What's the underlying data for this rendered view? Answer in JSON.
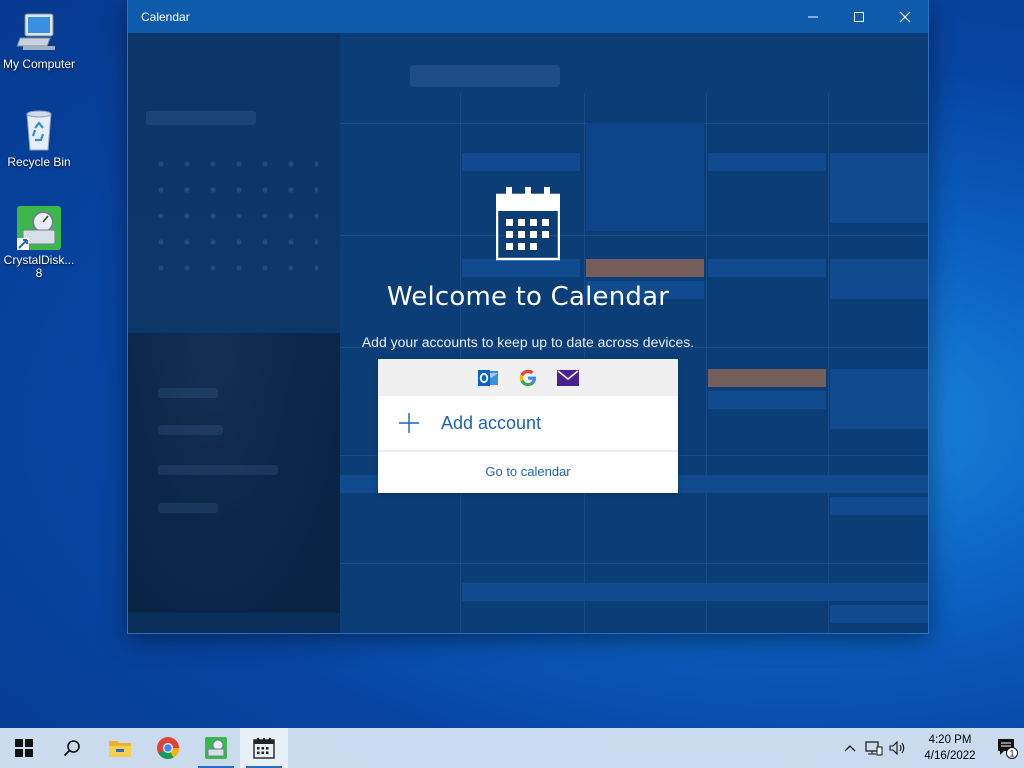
{
  "desktop": {
    "icons": [
      {
        "label": "My Computer",
        "icon": "computer-icon"
      },
      {
        "label": "Recycle Bin",
        "icon": "recycle-bin-icon"
      },
      {
        "label": "CrystalDisk...\n8",
        "icon": "crystaldisk-icon"
      }
    ]
  },
  "window": {
    "title": "Calendar",
    "controls": [
      "minimize",
      "maximize",
      "close"
    ]
  },
  "welcome": {
    "heading": "Welcome to Calendar",
    "subtitle": "Add your accounts to keep up to date across devices.",
    "providers": [
      "outlook-icon",
      "google-icon",
      "mail-icon"
    ],
    "add_account": "Add account",
    "go_to_calendar": "Go to calendar"
  },
  "taskbar": {
    "apps": [
      "start-icon",
      "search-icon",
      "file-explorer-icon",
      "chrome-icon",
      "crystaldisk-icon",
      "calendar-icon"
    ],
    "time": "4:20 PM",
    "date": "4/16/2022",
    "notification_count": "1"
  },
  "colors": {
    "accent": "#1d63b3",
    "titlebar": "#0e5aab",
    "desktop": "#0b63c4"
  }
}
